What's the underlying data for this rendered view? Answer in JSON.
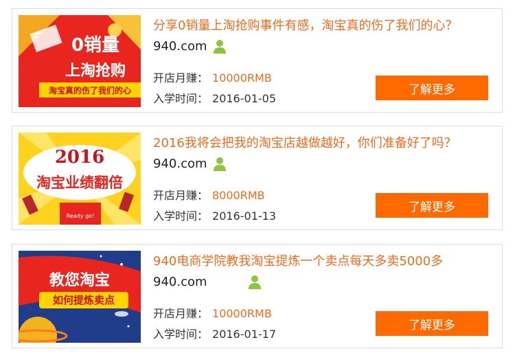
{
  "courses": [
    {
      "title": "分享0销量上淘抢购事件有感，淘宝真的伤了我们的心？",
      "author": "940.com",
      "income_label": "开店月赚：",
      "income_value": "10000RMB",
      "date_label": "入学时间：",
      "date_value": "2016-01-05",
      "button_label": "了解更多",
      "thumb": {
        "line1": "0销量",
        "line2": "上淘抢购",
        "line3": "淘宝真的伤了我们的心"
      }
    },
    {
      "title": "2016我将会把我的淘宝店越做越好，你们准备好了吗？",
      "author": "940.com",
      "income_label": "开店月赚：",
      "income_value": "8000RMB",
      "date_label": "入学时间：",
      "date_value": "2016-01-13",
      "button_label": "了解更多",
      "thumb": {
        "line1": "2016",
        "line2": "淘宝业绩翻倍",
        "line3": "Ready go!"
      }
    },
    {
      "title": "940电商学院教我淘宝提炼一个卖点每天多卖5000多",
      "author": "940.com",
      "income_label": "开店月赚：",
      "income_value": "10000RMB",
      "date_label": "入学时间：",
      "date_value": "2016-01-17",
      "button_label": "了解更多",
      "thumb": {
        "line1": "教您淘宝",
        "line2": "如何提炼卖点"
      }
    }
  ],
  "colors": {
    "accent": "#f26b1d",
    "button": "#ff6a00",
    "user_icon": "#8cc63f"
  },
  "icons": {
    "user": "user-icon"
  }
}
